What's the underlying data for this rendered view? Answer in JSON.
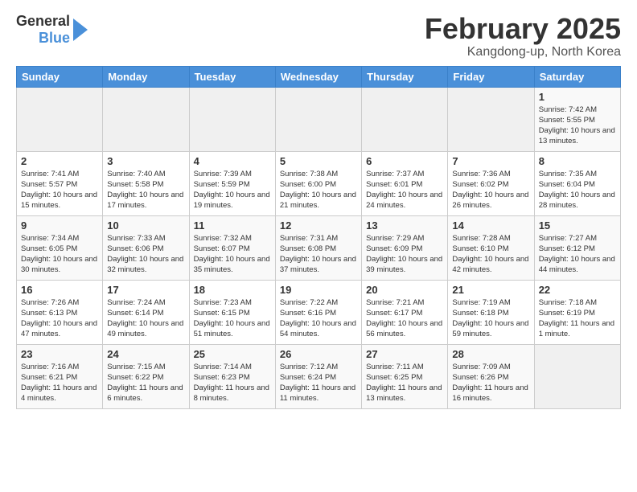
{
  "header": {
    "logo_line1": "General",
    "logo_line2": "Blue",
    "title": "February 2025",
    "subtitle": "Kangdong-up, North Korea"
  },
  "weekdays": [
    "Sunday",
    "Monday",
    "Tuesday",
    "Wednesday",
    "Thursday",
    "Friday",
    "Saturday"
  ],
  "weeks": [
    [
      {
        "day": "",
        "info": ""
      },
      {
        "day": "",
        "info": ""
      },
      {
        "day": "",
        "info": ""
      },
      {
        "day": "",
        "info": ""
      },
      {
        "day": "",
        "info": ""
      },
      {
        "day": "",
        "info": ""
      },
      {
        "day": "1",
        "info": "Sunrise: 7:42 AM\nSunset: 5:55 PM\nDaylight: 10 hours and 13 minutes."
      }
    ],
    [
      {
        "day": "2",
        "info": "Sunrise: 7:41 AM\nSunset: 5:57 PM\nDaylight: 10 hours and 15 minutes."
      },
      {
        "day": "3",
        "info": "Sunrise: 7:40 AM\nSunset: 5:58 PM\nDaylight: 10 hours and 17 minutes."
      },
      {
        "day": "4",
        "info": "Sunrise: 7:39 AM\nSunset: 5:59 PM\nDaylight: 10 hours and 19 minutes."
      },
      {
        "day": "5",
        "info": "Sunrise: 7:38 AM\nSunset: 6:00 PM\nDaylight: 10 hours and 21 minutes."
      },
      {
        "day": "6",
        "info": "Sunrise: 7:37 AM\nSunset: 6:01 PM\nDaylight: 10 hours and 24 minutes."
      },
      {
        "day": "7",
        "info": "Sunrise: 7:36 AM\nSunset: 6:02 PM\nDaylight: 10 hours and 26 minutes."
      },
      {
        "day": "8",
        "info": "Sunrise: 7:35 AM\nSunset: 6:04 PM\nDaylight: 10 hours and 28 minutes."
      }
    ],
    [
      {
        "day": "9",
        "info": "Sunrise: 7:34 AM\nSunset: 6:05 PM\nDaylight: 10 hours and 30 minutes."
      },
      {
        "day": "10",
        "info": "Sunrise: 7:33 AM\nSunset: 6:06 PM\nDaylight: 10 hours and 32 minutes."
      },
      {
        "day": "11",
        "info": "Sunrise: 7:32 AM\nSunset: 6:07 PM\nDaylight: 10 hours and 35 minutes."
      },
      {
        "day": "12",
        "info": "Sunrise: 7:31 AM\nSunset: 6:08 PM\nDaylight: 10 hours and 37 minutes."
      },
      {
        "day": "13",
        "info": "Sunrise: 7:29 AM\nSunset: 6:09 PM\nDaylight: 10 hours and 39 minutes."
      },
      {
        "day": "14",
        "info": "Sunrise: 7:28 AM\nSunset: 6:10 PM\nDaylight: 10 hours and 42 minutes."
      },
      {
        "day": "15",
        "info": "Sunrise: 7:27 AM\nSunset: 6:12 PM\nDaylight: 10 hours and 44 minutes."
      }
    ],
    [
      {
        "day": "16",
        "info": "Sunrise: 7:26 AM\nSunset: 6:13 PM\nDaylight: 10 hours and 47 minutes."
      },
      {
        "day": "17",
        "info": "Sunrise: 7:24 AM\nSunset: 6:14 PM\nDaylight: 10 hours and 49 minutes."
      },
      {
        "day": "18",
        "info": "Sunrise: 7:23 AM\nSunset: 6:15 PM\nDaylight: 10 hours and 51 minutes."
      },
      {
        "day": "19",
        "info": "Sunrise: 7:22 AM\nSunset: 6:16 PM\nDaylight: 10 hours and 54 minutes."
      },
      {
        "day": "20",
        "info": "Sunrise: 7:21 AM\nSunset: 6:17 PM\nDaylight: 10 hours and 56 minutes."
      },
      {
        "day": "21",
        "info": "Sunrise: 7:19 AM\nSunset: 6:18 PM\nDaylight: 10 hours and 59 minutes."
      },
      {
        "day": "22",
        "info": "Sunrise: 7:18 AM\nSunset: 6:19 PM\nDaylight: 11 hours and 1 minute."
      }
    ],
    [
      {
        "day": "23",
        "info": "Sunrise: 7:16 AM\nSunset: 6:21 PM\nDaylight: 11 hours and 4 minutes."
      },
      {
        "day": "24",
        "info": "Sunrise: 7:15 AM\nSunset: 6:22 PM\nDaylight: 11 hours and 6 minutes."
      },
      {
        "day": "25",
        "info": "Sunrise: 7:14 AM\nSunset: 6:23 PM\nDaylight: 11 hours and 8 minutes."
      },
      {
        "day": "26",
        "info": "Sunrise: 7:12 AM\nSunset: 6:24 PM\nDaylight: 11 hours and 11 minutes."
      },
      {
        "day": "27",
        "info": "Sunrise: 7:11 AM\nSunset: 6:25 PM\nDaylight: 11 hours and 13 minutes."
      },
      {
        "day": "28",
        "info": "Sunrise: 7:09 AM\nSunset: 6:26 PM\nDaylight: 11 hours and 16 minutes."
      },
      {
        "day": "",
        "info": ""
      }
    ]
  ]
}
